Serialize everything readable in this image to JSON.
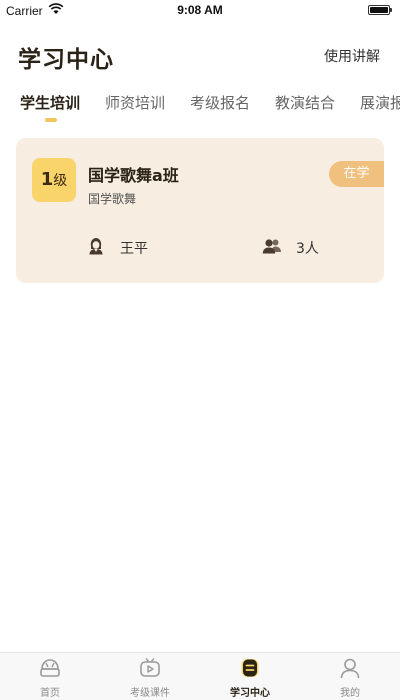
{
  "status_bar": {
    "carrier": "Carrier",
    "time": "9:08 AM"
  },
  "header": {
    "title": "学习中心",
    "help_label": "使用讲解"
  },
  "tabs": [
    {
      "label": "学生培训",
      "active": true
    },
    {
      "label": "师资培训",
      "active": false
    },
    {
      "label": "考级报名",
      "active": false
    },
    {
      "label": "教演结合",
      "active": false
    },
    {
      "label": "展演报",
      "active": false
    }
  ],
  "course_card": {
    "level_number": "1",
    "level_unit": "级",
    "name": "国学歌舞a班",
    "category": "国学歌舞",
    "status": "在学",
    "teacher": "王平",
    "student_count": "3人"
  },
  "bottom_nav": [
    {
      "label": "首页",
      "icon": "home-icon",
      "active": false
    },
    {
      "label": "考级课件",
      "icon": "video-courseware-icon",
      "active": false
    },
    {
      "label": "学习中心",
      "icon": "study-center-icon",
      "active": true
    },
    {
      "label": "我的",
      "icon": "profile-icon",
      "active": false
    }
  ],
  "colors": {
    "accent": "#f9d46b",
    "card_bg": "#f7ede0",
    "status_badge": "#f0c07e"
  }
}
